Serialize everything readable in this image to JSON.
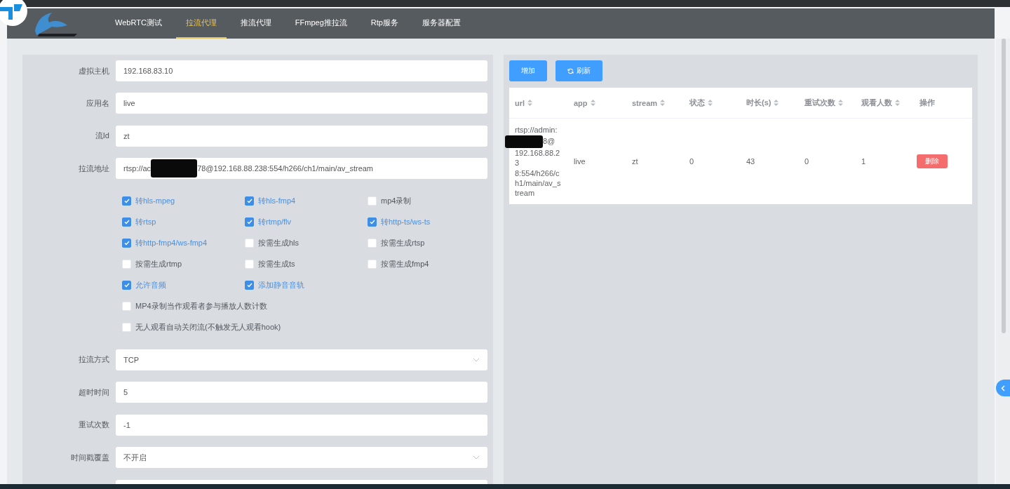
{
  "nav": {
    "items": [
      {
        "label": "WebRTC测试",
        "selected": false
      },
      {
        "label": "拉流代理",
        "selected": true
      },
      {
        "label": "推流代理",
        "selected": false
      },
      {
        "label": "FFmpeg推拉流",
        "selected": false
      },
      {
        "label": "Rtp服务",
        "selected": false
      },
      {
        "label": "服务器配置",
        "selected": false
      }
    ]
  },
  "form": {
    "fields_top": [
      {
        "label": "虚拟主机",
        "kind": "text",
        "value": "192.168.83.10"
      },
      {
        "label": "应用名",
        "kind": "text",
        "value": "live"
      },
      {
        "label": "流Id",
        "kind": "text",
        "value": "zt"
      },
      {
        "label": "拉流地址",
        "kind": "redacted",
        "value": "rtsp://ac",
        "value_after": "78@192.168.88.238:554/h266/ch1/main/av_stream"
      }
    ],
    "option_rows": [
      [
        {
          "label": "转hls-mpeg",
          "checked": true
        },
        {
          "label": "转hls-fmp4",
          "checked": true
        },
        {
          "label": "mp4录制",
          "checked": false
        }
      ],
      [
        {
          "label": "转rtsp",
          "checked": true
        },
        {
          "label": "转rtmp/flv",
          "checked": true
        },
        {
          "label": "转http-ts/ws-ts",
          "checked": true
        }
      ],
      [
        {
          "label": "转http-fmp4/ws-fmp4",
          "checked": true
        },
        {
          "label": "按需生成hls",
          "checked": false
        },
        {
          "label": "按需生成rtsp",
          "checked": false
        }
      ],
      [
        {
          "label": "按需生成rtmp",
          "checked": false
        },
        {
          "label": "按需生成ts",
          "checked": false
        },
        {
          "label": "按需生成fmp4",
          "checked": false
        }
      ],
      [
        {
          "label": "允许音频",
          "checked": true
        },
        {
          "label": "添加静音音轨",
          "checked": true
        }
      ],
      [
        {
          "label": "MP4录制当作观看者参与播放人数计数",
          "checked": false
        }
      ],
      [
        {
          "label": "无人观看自动关闭流(不触发无人观看hook)",
          "checked": false
        }
      ]
    ],
    "fields_bottom": [
      {
        "label": "拉流方式",
        "kind": "select",
        "value": "TCP"
      },
      {
        "label": "超时时间",
        "kind": "text",
        "value": "5"
      },
      {
        "label": "重试次数",
        "kind": "text",
        "value": "-1"
      },
      {
        "label": "时间戳覆盖",
        "kind": "select",
        "value": "不开启"
      },
      {
        "kind": "text"
      }
    ]
  },
  "toolbar": {
    "add": "增加",
    "refresh": "刷新"
  },
  "table": {
    "columns": [
      {
        "label": "url",
        "sortable": true
      },
      {
        "label": "app",
        "sortable": true
      },
      {
        "label": "stream",
        "sortable": true
      },
      {
        "label": "状态",
        "sortable": true
      },
      {
        "label": "时长(s)",
        "sortable": true
      },
      {
        "label": "重试次数",
        "sortable": true
      },
      {
        "label": "观看人数",
        "sortable": true
      },
      {
        "label": "操作",
        "sortable": false
      }
    ],
    "rows": [
      {
        "cells": [
          "rtsp://admin:",
          "live",
          "zt",
          "0",
          "43",
          "0",
          "1"
        ],
        "url_after_lines": [
          "8@",
          "192.168.88.23",
          "8:554/h266/c",
          "h1/main/av_s",
          "tream"
        ],
        "action": "删除"
      }
    ]
  }
}
